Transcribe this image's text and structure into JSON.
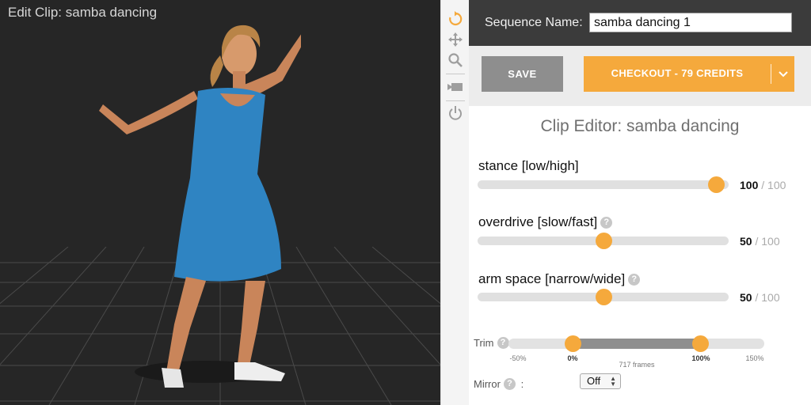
{
  "viewport": {
    "title": "Edit Clip: samba dancing"
  },
  "toolbar": {
    "icons": [
      "reset-icon",
      "move-icon",
      "zoom-icon",
      "camera-icon",
      "power-icon"
    ],
    "accent": "#f5a93c"
  },
  "header": {
    "sequence_label": "Sequence Name:",
    "sequence_value": "samba dancing 1"
  },
  "actions": {
    "save_label": "SAVE",
    "checkout_label": "CHECKOUT - 79 CREDITS"
  },
  "editor": {
    "title": "Clip Editor: samba dancing",
    "params": [
      {
        "label": "stance [low/high]",
        "value": "100",
        "max": "/ 100",
        "has_help": false
      },
      {
        "label": "overdrive [slow/fast]",
        "value": "50",
        "max": "/ 100",
        "has_help": true
      },
      {
        "label": "arm space [narrow/wide]",
        "value": "50",
        "max": "/ 100",
        "has_help": true
      }
    ],
    "help_glyph": "?",
    "trim": {
      "label": "Trim",
      "ticks": [
        "-50%",
        "0%",
        "100%",
        "150%"
      ],
      "frames": "717 frames",
      "start_pct": 0,
      "end_pct": 100
    },
    "mirror": {
      "label": "Mirror",
      "colon": ":",
      "value": "Off"
    }
  },
  "colors": {
    "accent": "#f5a93c",
    "header_bg": "#3b3b3b",
    "save_bg": "#8e8e8e",
    "viewport_bg": "#262626"
  }
}
